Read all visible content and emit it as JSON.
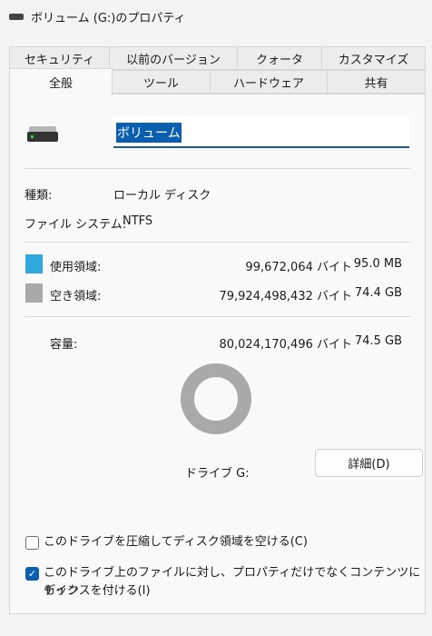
{
  "window": {
    "title": "ボリューム (G:)のプロパティ"
  },
  "tabs_back": [
    "セキュリティ",
    "以前のバージョン",
    "クォータ",
    "カスタマイズ"
  ],
  "tabs_front": [
    "全般",
    "ツール",
    "ハードウェア",
    "共有"
  ],
  "general": {
    "volume_name": "ボリューム",
    "type_label": "種類:",
    "type_value": "ローカル ディスク",
    "fs_label": "ファイル システム:",
    "fs_value": "NTFS",
    "used": {
      "label": "使用領域:",
      "bytes": "99,672,064 バイト",
      "size": "95.0 MB",
      "color": "#2fa8dd"
    },
    "free": {
      "label": "空き領域:",
      "bytes": "79,924,498,432 バイト",
      "size": "74.4 GB",
      "color": "#a9a9a9"
    },
    "capacity": {
      "label": "容量:",
      "bytes": "80,024,170,496 バイト",
      "size": "74.5 GB"
    },
    "used_fraction": 0.0012,
    "drive_label": "ドライブ G:",
    "details_button": "詳細(D)",
    "compress_label": "このドライブを圧縮してディスク領域を空ける(C)",
    "compress_checked": false,
    "index_label_line1": "このドライブ上のファイルに対し、プロパティだけでなくコンテンツにもイン",
    "index_label_line2": "デックスを付ける(I)",
    "index_checked": true
  },
  "icons": {
    "drive": "hard-drive-icon",
    "title": "drive-title-icon",
    "check": "checkmark-icon"
  }
}
